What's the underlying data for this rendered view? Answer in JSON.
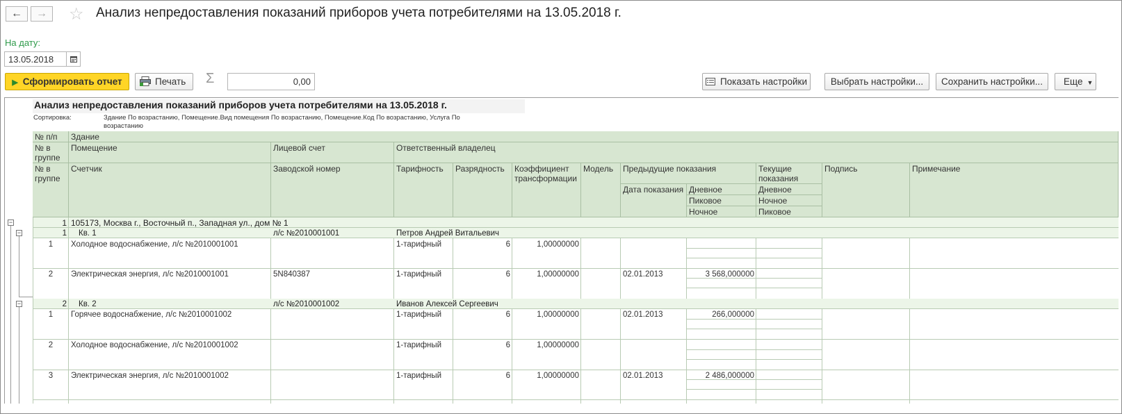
{
  "header": {
    "title": "Анализ непредоставления показаний приборов учета потребителями на 13.05.2018 г.",
    "back_icon": "←",
    "fwd_icon": "→",
    "star_icon": "☆"
  },
  "filter": {
    "date_label": "На дату:",
    "date_value": "13.05.2018"
  },
  "toolbar": {
    "generate_label": "Сформировать отчет",
    "print_label": "Печать",
    "sum_sign": "Σ",
    "sum_value": "0,00",
    "show_settings_label": "Показать настройки",
    "choose_settings_label": "Выбрать настройки...",
    "save_settings_label": "Сохранить настройки...",
    "more_label": "Еще"
  },
  "report": {
    "title": "Анализ непредоставления показаний приборов учета потребителями на 13.05.2018 г.",
    "sort_label": "Сортировка:",
    "sort_value": "Здание По возрастанию, Помещение.Вид помещения По возрастанию, Помещение.Код По возрастанию, Услуга По возрастанию",
    "headers": {
      "np": "№ п/п",
      "building": "Здание",
      "in_group": "№ в группе",
      "room": "Помещение",
      "account": "Лицевой счет",
      "owner": "Ответственный владелец",
      "meter": "Счетчик",
      "serial": "Заводской номер",
      "tariff": "Тарифность",
      "digits": "Разрядность",
      "coef": "Коэффициент трансформации",
      "model": "Модель",
      "prev": "Предыдущие показания",
      "prev_date": "Дата показания",
      "day": "Дневное",
      "peak": "Пиковое",
      "night": "Ночное",
      "current": "Текущие показания",
      "cur_day": "Дневное",
      "cur_night": "Ночное",
      "cur_peak": "Пиковое",
      "signature": "Подпись",
      "note": "Примечание"
    },
    "building_row": {
      "num": "1",
      "name": "105173, Москва г., Восточный п., Западная ул., дом № 1"
    },
    "groups": [
      {
        "num": "1",
        "room": "Кв. 1",
        "account": "л/с №2010001001",
        "owner": "Петров Андрей Витальевич",
        "rows": [
          {
            "num": "1",
            "meter": "Холодное водоснабжение, л/с №2010001001",
            "serial": "",
            "tariff": "1-тарифный",
            "digits": "6",
            "coef": "1,00000000",
            "date": "",
            "value": ""
          },
          {
            "num": "2",
            "meter": "Электрическая энергия, л/с №2010001001",
            "serial": "5N840387",
            "tariff": "1-тарифный",
            "digits": "6",
            "coef": "1,00000000",
            "date": "02.01.2013",
            "value": "3 568,000000"
          }
        ]
      },
      {
        "num": "2",
        "room": "Кв. 2",
        "account": "л/с №2010001002",
        "owner": "Иванов Алексей Сергеевич",
        "rows": [
          {
            "num": "1",
            "meter": "Горячее водоснабжение, л/с №2010001002",
            "serial": "",
            "tariff": "1-тарифный",
            "digits": "6",
            "coef": "1,00000000",
            "date": "02.01.2013",
            "value": "266,000000"
          },
          {
            "num": "2",
            "meter": "Холодное водоснабжение, л/с №2010001002",
            "serial": "",
            "tariff": "1-тарифный",
            "digits": "6",
            "coef": "1,00000000",
            "date": "",
            "value": ""
          },
          {
            "num": "3",
            "meter": "Электрическая энергия, л/с №2010001002",
            "serial": "",
            "tariff": "1-тарифный",
            "digits": "6",
            "coef": "1,00000000",
            "date": "02.01.2013",
            "value": "2 486,000000"
          }
        ]
      }
    ]
  }
}
